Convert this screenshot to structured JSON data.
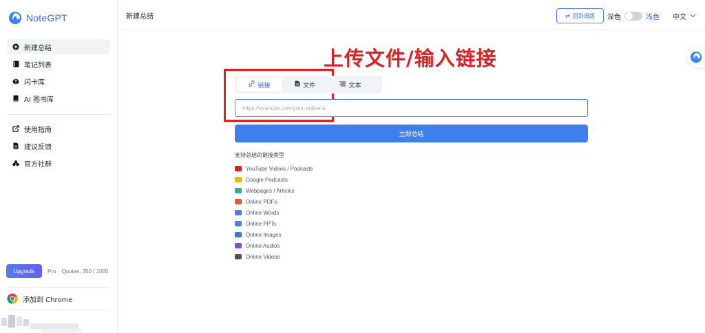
{
  "app": {
    "name": "NoteGPT"
  },
  "sidebar": {
    "items": [
      {
        "label": "新建总结",
        "icon": "plus-circle-icon",
        "active": true
      },
      {
        "label": "笔记列表",
        "icon": "notebook-icon"
      },
      {
        "label": "闪卡库",
        "icon": "brain-icon"
      },
      {
        "label": "AI 图书库",
        "icon": "book-icon"
      }
    ],
    "items2": [
      {
        "label": "使用指南",
        "icon": "external-edit-icon"
      },
      {
        "label": "建议反馈",
        "icon": "document-icon"
      },
      {
        "label": "官方社群",
        "icon": "community-icon"
      }
    ],
    "upgrade_label": "Upgrade",
    "plan": "Pro",
    "quota": "Quotas: 350 / 1000",
    "chrome_label": "添加到 Chrome"
  },
  "header": {
    "title": "新建总结",
    "old_version_label": "回到旧版",
    "dark_label": "深色",
    "light_label": "浅色",
    "language": "中文"
  },
  "main": {
    "annotation": "上传文件/输入链接",
    "tabs": [
      {
        "label": "链接",
        "icon": "link-icon"
      },
      {
        "label": "文件",
        "icon": "file-icon"
      },
      {
        "label": "文本",
        "icon": "text-icon"
      }
    ],
    "url_placeholder": "https://example.com/your-online-u",
    "submit_label": "立即总结",
    "supported_title": "支持总结的链接类型",
    "supported": [
      {
        "label": "YouTube Videos / Podcasts",
        "color": "#e02020"
      },
      {
        "label": "Google Podcasts",
        "color": "#f4b400"
      },
      {
        "label": "Webpages / Articles",
        "color": "#3aa88c"
      },
      {
        "label": "Online PDFs",
        "color": "#e5583b"
      },
      {
        "label": "Online Words",
        "color": "#4b7bec"
      },
      {
        "label": "Online PPTs",
        "color": "#4b7bec"
      },
      {
        "label": "Online Images",
        "color": "#2f80c8"
      },
      {
        "label": "Online Audios",
        "color": "#7b4fd6"
      },
      {
        "label": "Online Videos",
        "color": "#555555"
      }
    ]
  },
  "colors": {
    "accent": "#3e7ff0",
    "annotation": "#e02020"
  }
}
